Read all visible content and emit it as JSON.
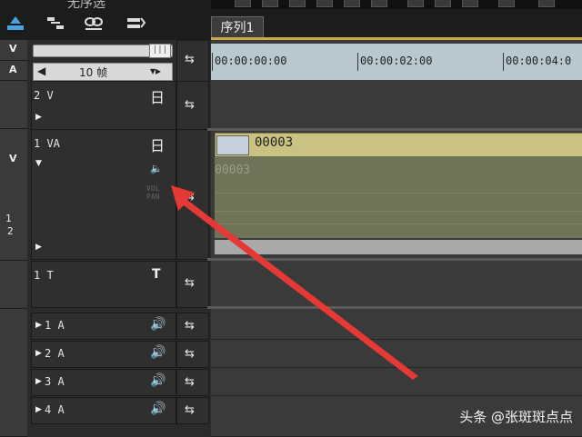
{
  "toolbar": {
    "title_fragment": "无序选",
    "icons": [
      "insert-icon",
      "overwrite-icon",
      "link-icon",
      "group-icon"
    ]
  },
  "sequence": {
    "tab_label": "序列1"
  },
  "zoom": {
    "slider_thumb": "|||"
  },
  "frame_step": {
    "value": "10 帧"
  },
  "ruler": {
    "timecodes": [
      "00:00:00:00",
      "00:00:02:00",
      "00:00:04:0"
    ]
  },
  "tracks": {
    "v2": {
      "name": "2 V"
    },
    "va1": {
      "name": "1 VA",
      "strip_label_1": "1",
      "strip_label_2": "2"
    },
    "t1": {
      "name": "1 T",
      "icon_text": "T"
    },
    "audio": [
      {
        "name": "1 A"
      },
      {
        "name": "2 A"
      },
      {
        "name": "3 A"
      },
      {
        "name": "4 A"
      }
    ]
  },
  "side_strip": {
    "v_label": "V",
    "a_label": "A",
    "va_label": "V"
  },
  "clip": {
    "video_name": "00003",
    "audio_name": "00003",
    "faint_label": "VOL\nPAN"
  },
  "watermark": {
    "text": "头条 @张斑斑点点"
  },
  "colors": {
    "ruler_bg": "#b9c7cf",
    "clip_video": "#c9c283",
    "clip_audio": "#6f7357",
    "arrow": "#e53935",
    "tab_underline": "#c8a84b"
  }
}
